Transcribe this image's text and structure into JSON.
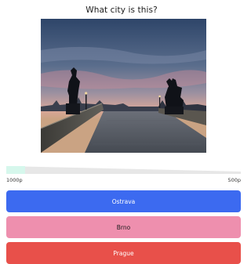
{
  "quiz": {
    "question": "What city is this?",
    "image_alt": "Stone bridge with statues at dusk",
    "timer": {
      "remaining_fraction": 0.08,
      "start_points_label": "1000p",
      "end_points_label": "500p"
    },
    "answers": [
      {
        "label": "Ostrava",
        "color": "#3c6af0"
      },
      {
        "label": "Brno",
        "color": "#ee8fae"
      },
      {
        "label": "Prague",
        "color": "#e8504a"
      }
    ]
  }
}
